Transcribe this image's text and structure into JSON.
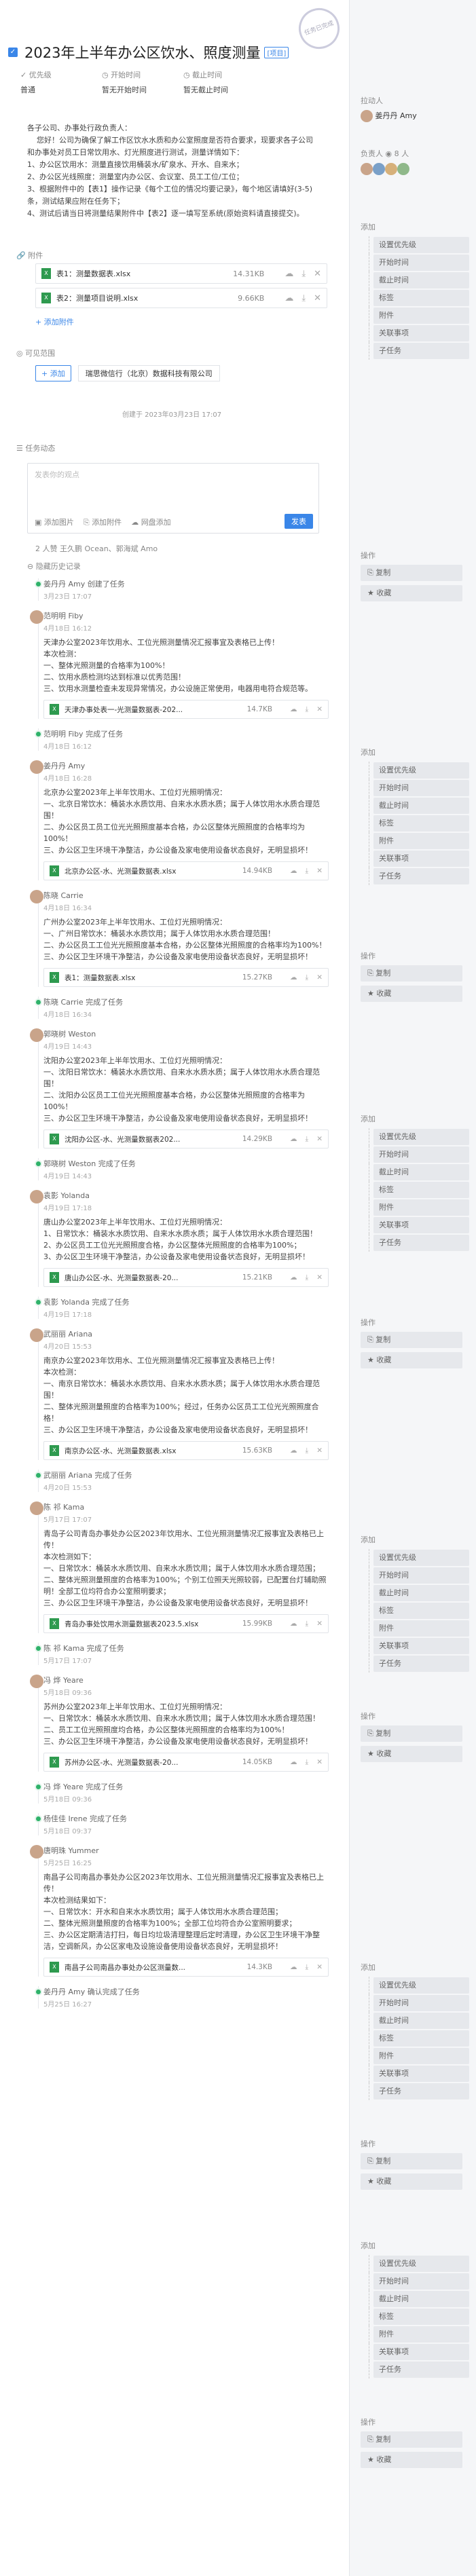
{
  "header": {
    "title": "2023年上半年办公区饮水、照度测量",
    "badge": "[项目]",
    "stamp": "任务已完成"
  },
  "meta": {
    "priority_label": "优先级",
    "start_label": "开始时间",
    "due_label": "截止时间",
    "priority_value": "普通",
    "start_value": "暂无开始时间",
    "due_value": "暂无截止时间"
  },
  "description": "各子公司、办事处行政负责人：\n    您好！公司为确保了解工作区饮水水质和办公室照度是否符合要求，现要求各子公司和办事处对员工日常饮用水、灯光照度进行测试，测量详情如下：\n1、办公区饮用水：测量直接饮用桶装水/矿泉水、开水、自来水；\n2、办公区光线照度：测量室内办公区、会议室、员工工位/工位；\n3、根据附件中的【表1】操作记录《每个工位的情况均要记录》，每个地区请填好(3-5)条，测试结果应附在任务下；\n4、测试后请当日将测量结果附件中【表2】逐一填写至系统(原始资料请直接提交)。",
  "attachments": {
    "label": "附件",
    "add_label": "+ 添加附件",
    "items": [
      {
        "name": "表1：测量数据表.xlsx",
        "size": "14.31KB"
      },
      {
        "name": "表2：测量项目说明.xlsx",
        "size": "9.66KB"
      }
    ]
  },
  "scope": {
    "label": "可见范围",
    "add_label": "+ 添加",
    "org": "瑞思微信行（北京）数据科技有限公司",
    "created": "创建于 2023年03月23日 17:07"
  },
  "dynamics": {
    "label": "任务动态",
    "placeholder": "发表你的观点",
    "tools": [
      "添加图片",
      "添加附件",
      "网盘添加"
    ],
    "send": "发表",
    "participants": "2 人赞  王久鹏 Ocean、郭海斌 Amo",
    "history": "隐藏历史记录"
  },
  "feed": [
    {
      "type": "done",
      "who": "姜丹丹 Amy 创建了任务",
      "time": "3月23日 17:07"
    },
    {
      "type": "comment",
      "who": "范明明 Fiby",
      "time": "4月18日 16:12",
      "body": "天津办公室2023年饮用水、工位光照测量情况汇报事宜及表格已上传！\n本次检测：\n一、整体光照测量的合格率为100%！\n二、饮用水质检测均达到标准以优秀范围！\n三、饮用水测量检查未发现异常情况，办公设施正常使用，电器用电符合规范等。",
      "file": "天津办事处表一-光测量数据表-202...",
      "size": "14.7KB"
    },
    {
      "type": "done",
      "who": "范明明 Fiby 完成了任务",
      "time": "4月18日 16:12"
    },
    {
      "type": "comment",
      "who": "姜丹丹 Amy",
      "time": "4月18日 16:28",
      "body": "北京办公室2023年上半年饮用水、工位灯光照明情况：\n一、北京日常饮水：桶装水水质饮用、自来水水质水质；属于人体饮用水水质合理范围！\n二、办公区员工员工位光光照照度基本合格，办公区整体光照照度的合格率均为100%！\n三、办公区卫生环境干净整洁，办公设备及家电使用设备状态良好，无明显损坏！",
      "file": "北京办公区-水、光测量数据表.xlsx",
      "size": "14.94KB"
    },
    {
      "type": "comment",
      "who": "陈晓 Carrie",
      "time": "4月18日 16:34",
      "body": "广州办公室2023年上半年饮用水、工位灯光照明情况：\n一、广州日常饮水：桶装水水质饮用；属于人体饮用水水质合理范围！\n二、办公区员工工位光光照照度基本合格，办公区整体光照照度的合格率均为100%！\n三、办公区卫生环境干净整洁，办公设备及家电使用设备状态良好，无明显损坏！",
      "file": "表1：测量数据表.xlsx",
      "size": "15.27KB"
    },
    {
      "type": "done",
      "who": "陈晓 Carrie 完成了任务",
      "time": "4月18日 16:34"
    },
    {
      "type": "comment",
      "who": "郭晓树 Weston",
      "time": "4月19日 14:43",
      "body": "沈阳办公室2023年上半年饮用水、工位灯光照明情况：\n一、沈阳日常饮水：桶装水水质饮用、自来水水质水质；属于人体饮用水水质合理范围！\n二、沈阳办公区员工工位光光照照度基本合格，办公区整体光照照度的合格率为100%！\n三、办公区卫生环境干净整洁，办公设备及家电使用设备状态良好，无明显损坏！",
      "file": "沈阳办公区-水、光测量数据表202...",
      "size": "14.29KB"
    },
    {
      "type": "done",
      "who": "郭晓树 Weston 完成了任务",
      "time": "4月19日 14:43"
    },
    {
      "type": "comment",
      "who": "袁影 Yolanda",
      "time": "4月19日 17:18",
      "body": "唐山办公室2023年上半年饮用水、工位灯光照明情况：\n1、日常饮水：桶装水水质饮用、自来水水质水质；属于人体饮用水水质合理范围！\n2、办公区员工工位光光照照度合格，办公区整体光照照度的合格率为100%；\n3、办公区卫生环境干净整洁，办公设备及家电使用设备状态良好，无明显损坏！",
      "file": "唐山办公区-水、光测量数据表-20...",
      "size": "15.21KB"
    },
    {
      "type": "done",
      "who": "袁影 Yolanda 完成了任务",
      "time": "4月19日 17:18"
    },
    {
      "type": "comment",
      "who": "武丽丽 Ariana",
      "time": "4月20日 15:53",
      "body": "南京办公室2023年饮用水、工位光照测量情况汇报事宜及表格已上传！\n本次检测：\n一、南京日常饮水：桶装水水质饮用、自来水水质水质；属于人体饮用水水质合理范围！\n二、整体光照测量照度的合格率为100%；经过，任务办公区员工工位光光照照度合格！\n三、办公区卫生环境干净整洁，办公设备及家电使用设备状态良好，无明显损坏！",
      "file": "南京办公区-水、光测量数据表.xlsx",
      "size": "15.63KB"
    },
    {
      "type": "done",
      "who": "武丽丽 Ariana 完成了任务",
      "time": "4月20日 15:53"
    },
    {
      "type": "comment",
      "who": "陈 祁 Kama",
      "time": "5月17日 17:07",
      "body": "青岛子公司青岛办事处办公区2023年饮用水、工位光照测量情况汇报事宜及表格已上传！\n本次检测如下：\n一、日常饮水：桶装水水质饮用、自来水水质饮用；属于人体饮用水水质合理范围；\n二、整体光照测量照度的合格率为100%；个别工位照天光照较弱，已配置台灯辅助照明！全部工位均符合办公室照明要求；\n三、办公区卫生环境干净整洁，办公设备及家电使用设备状态良好，无明显损坏！",
      "file": "青岛办事处饮用水测量数据表2023.5.xlsx",
      "size": "15.99KB"
    },
    {
      "type": "done",
      "who": "陈 祁 Kama 完成了任务",
      "time": "5月17日 17:07"
    },
    {
      "type": "comment",
      "who": "冯 烨 Yeare",
      "time": "5月18日 09:36",
      "body": "苏州办公室2023年上半年饮用水、工位灯光照明情况：\n一、日常饮水：桶装水水质饮用、自来水水质饮用；属于人体饮用水水质合理范围！\n二、员工工位光照照度均合格，办公区整体光照照度的合格率均为100%！\n三、办公区卫生环境干净整洁，办公设备及家电使用设备状态良好，无明显损坏！",
      "file": "苏州办公区-水、光测量数据表-20...",
      "size": "14.05KB"
    },
    {
      "type": "done",
      "who": "冯 烨 Yeare 完成了任务",
      "time": "5月18日 09:36"
    },
    {
      "type": "done",
      "who": "杨佳佳 Irene 完成了任务",
      "time": "5月18日 09:37"
    },
    {
      "type": "comment",
      "who": "唐明珠 Yummer",
      "time": "5月25日 16:25",
      "body": "南昌子公司南昌办事处办公区2023年饮用水、工位光照测量情况汇报事宜及表格已上传！\n本次检测结果如下：\n一、日常饮水：开水和自来水水质饮用；属于人体饮用水水质合理范围；\n二、整体光照测量照度的合格率为100%；全部工位均符合办公室照明要求；\n三、办公区定期清洁打扫，每日均垃圾清理整理后定时清理，办公区卫生环境干净整洁，空调新风，办公区家电及设施设备使用设备状态良好，无明显损坏！",
      "file": "南昌子公司南昌办事处办公区测量数...",
      "size": "14.3KB"
    },
    {
      "type": "done",
      "who": "姜丹丹 Amy 确认完成了任务",
      "time": "5月25日 16:27"
    }
  ],
  "sidebar": {
    "owner_label": "拉动人",
    "owner_name": "姜丹丹 Amy",
    "members_label": "负责人",
    "members_count": "8 人",
    "add_label": "添加",
    "fields": [
      "设置优先级",
      "开始时间",
      "截止时间",
      "标签",
      "附件",
      "关联事项",
      "子任务"
    ],
    "ops_label": "操作",
    "ops": [
      "复制",
      "收藏"
    ]
  }
}
